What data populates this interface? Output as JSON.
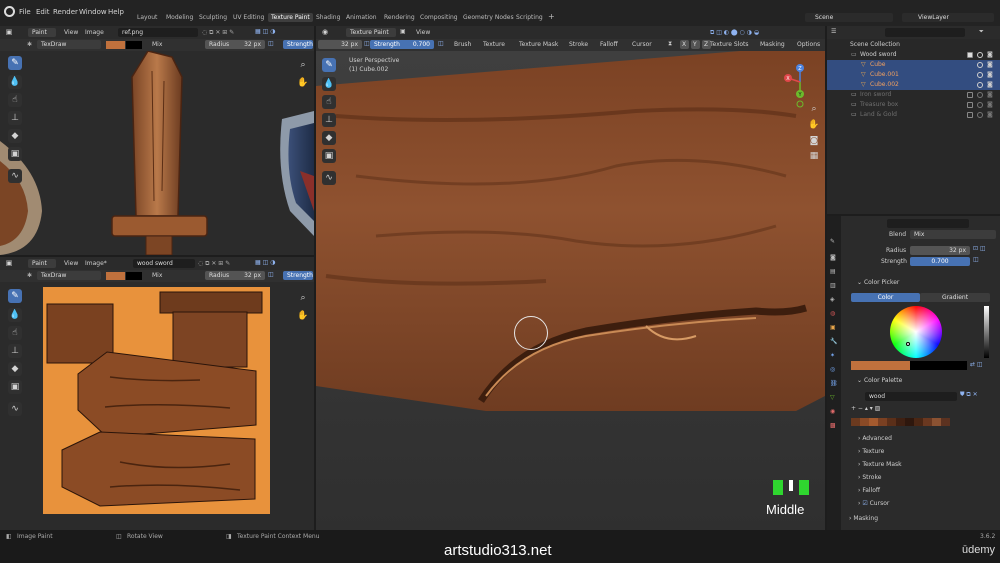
{
  "menu": [
    "File",
    "Edit",
    "Render",
    "Window",
    "Help"
  ],
  "workspaces": [
    "Layout",
    "Modeling",
    "Sculpting",
    "UV Editing",
    "Texture Paint",
    "Shading",
    "Animation",
    "Rendering",
    "Compositing",
    "Geometry Nodes",
    "Scripting"
  ],
  "scene": {
    "name": "Scene",
    "view_layer": "ViewLayer"
  },
  "top_left_editor": {
    "mode": "Paint",
    "menus": [
      "View",
      "Image"
    ],
    "image_name": "ref.png",
    "brush": "TexDraw",
    "blend": "Mix",
    "radius_label": "Radius",
    "radius_value": "32 px",
    "strength_label": "Strength"
  },
  "bottom_left_editor": {
    "mode": "Paint",
    "menus": [
      "View",
      "Image*"
    ],
    "image_name": "wood sword",
    "brush": "TexDraw",
    "blend": "Mix",
    "radius_label": "Radius",
    "radius_value": "32 px",
    "strength_label": "Strength"
  },
  "viewport": {
    "mode": "Texture Paint",
    "menu": "View",
    "radius_value": "32 px",
    "strength_label": "Strength",
    "strength_value": "0.700",
    "header_menus": [
      "Brush",
      "Texture",
      "Texture Mask",
      "Stroke",
      "Falloff",
      "Cursor"
    ],
    "axes": [
      "X",
      "Y",
      "Z"
    ],
    "texture_slots": "Texture Slots",
    "masking": "Masking",
    "options": "Options",
    "perspective": "User Perspective",
    "object": "(1) Cube.002",
    "key_indicator": "Middle",
    "gizmo_axes": [
      "Z",
      "Y",
      "X"
    ]
  },
  "outliner": {
    "items": [
      {
        "label": "Scene Collection",
        "indent": 0,
        "selected": false,
        "dim": false
      },
      {
        "label": "Wood sword",
        "indent": 1,
        "selected": false,
        "dim": false
      },
      {
        "label": "Cube",
        "indent": 2,
        "selected": true,
        "dim": false
      },
      {
        "label": "Cube.001",
        "indent": 2,
        "selected": true,
        "dim": false
      },
      {
        "label": "Cube.002",
        "indent": 2,
        "selected": true,
        "dim": false
      },
      {
        "label": "Iron sword",
        "indent": 1,
        "selected": false,
        "dim": true
      },
      {
        "label": "Treasure box",
        "indent": 1,
        "selected": false,
        "dim": true
      },
      {
        "label": "Land & Gold",
        "indent": 1,
        "selected": false,
        "dim": true
      }
    ]
  },
  "properties": {
    "blend_label": "Blend",
    "blend_value": "Mix",
    "radius_label": "Radius",
    "radius_value": "32 px",
    "strength_label": "Strength",
    "strength_value": "0.700",
    "color_picker_label": "Color Picker",
    "tab_color": "Color",
    "tab_gradient": "Gradient",
    "palette_label": "Color Palette",
    "palette_name": "wood",
    "palette_colors": [
      "#6b3a1f",
      "#8a4a26",
      "#a45a2e",
      "#7a4022",
      "#5b2f19",
      "#3f2012",
      "#2e170d",
      "#4a2614",
      "#6a3820",
      "#8b5232",
      "#5c3220"
    ],
    "sections": [
      "Advanced",
      "Texture",
      "Texture Mask",
      "Stroke",
      "Falloff",
      "Cursor"
    ],
    "masking": "Masking"
  },
  "status": {
    "left": "Image Paint",
    "middle": "Rotate View",
    "right": "Texture Paint Context Menu",
    "version": "3.6.2"
  },
  "watermark": "artstudio313.net",
  "udemy": "ūdemy",
  "colors": {
    "accent": "#4772b3",
    "brush_color": "#c0713d",
    "orange_bg": "#e8923c"
  }
}
